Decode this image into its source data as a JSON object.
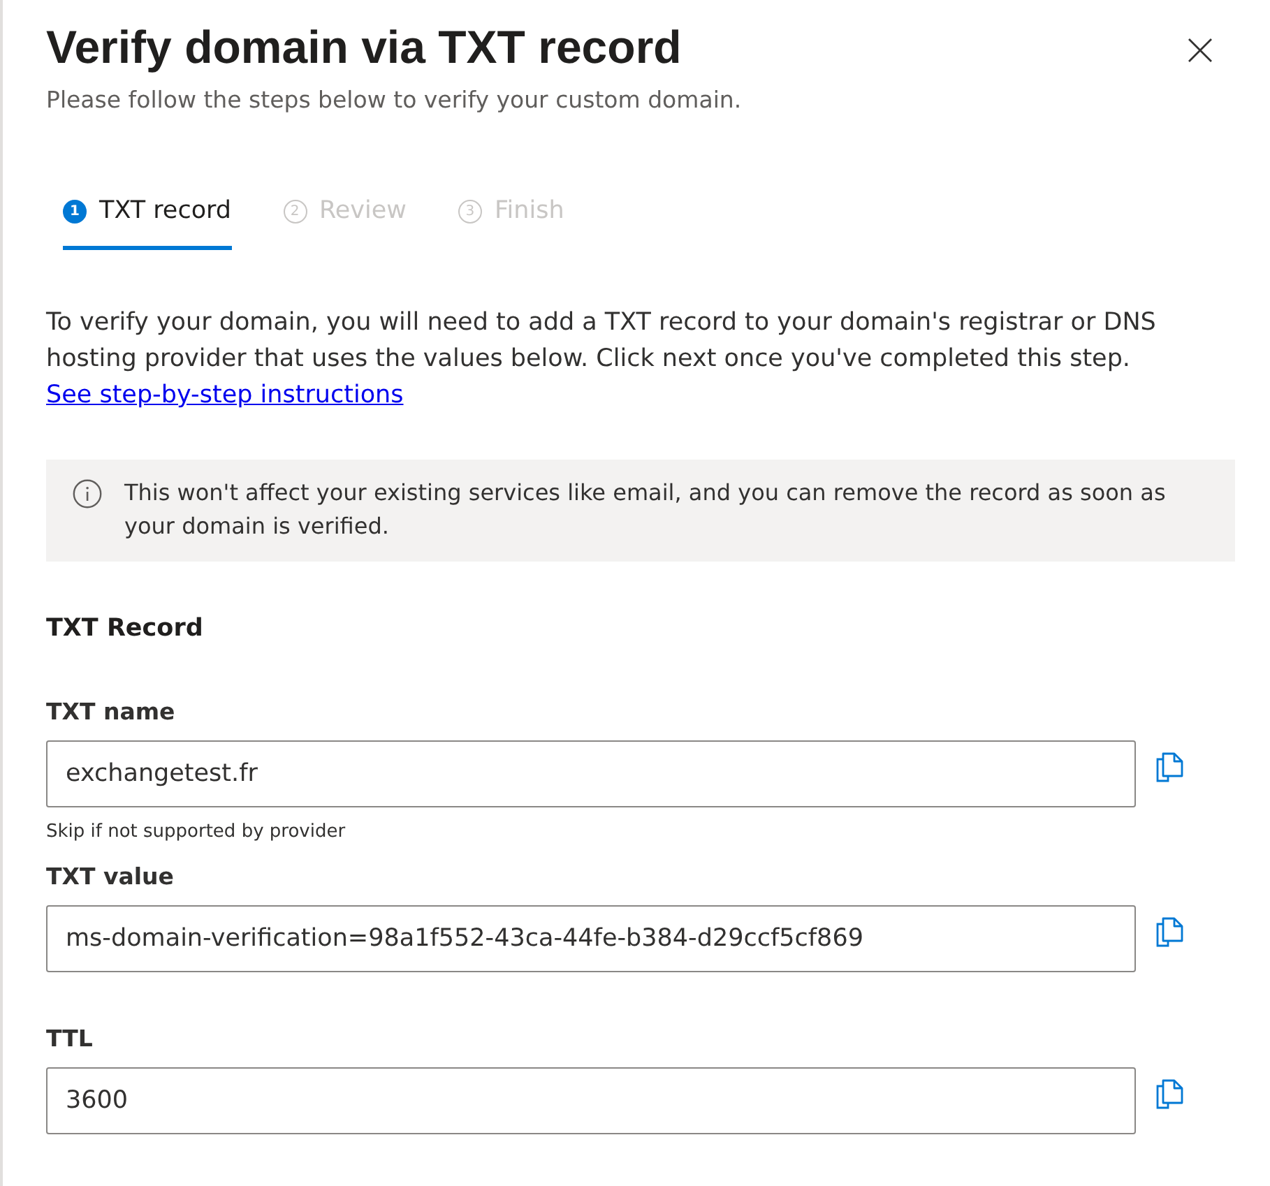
{
  "dialog": {
    "title": "Verify domain via TXT record",
    "subtitle": "Please follow the steps below to verify your custom domain."
  },
  "steps": [
    {
      "number": "1",
      "label": "TXT record",
      "selected": true,
      "disabled": false
    },
    {
      "number": "2",
      "label": "Review",
      "selected": false,
      "disabled": true
    },
    {
      "number": "3",
      "label": "Finish",
      "selected": false,
      "disabled": true
    }
  ],
  "intro": {
    "text": "To verify your domain, you will need to add a TXT record to your domain's registrar or DNS hosting provider that uses the values below. Click next once you've completed this step.",
    "link": "See step-by-step instructions"
  },
  "info_banner": {
    "text": "This won't affect your existing services like email, and you can remove the record as soon as your domain is verified."
  },
  "section": {
    "heading": "TXT Record",
    "fields": [
      {
        "label": "TXT name",
        "value": "exchangetest.fr",
        "help_text": "Skip if not supported by provider"
      },
      {
        "label": "TXT value",
        "value": "ms-domain-verification=98a1f552-43ca-44fe-b384-d29ccf5cf869"
      },
      {
        "label": "TTL",
        "value": "3600"
      }
    ]
  }
}
